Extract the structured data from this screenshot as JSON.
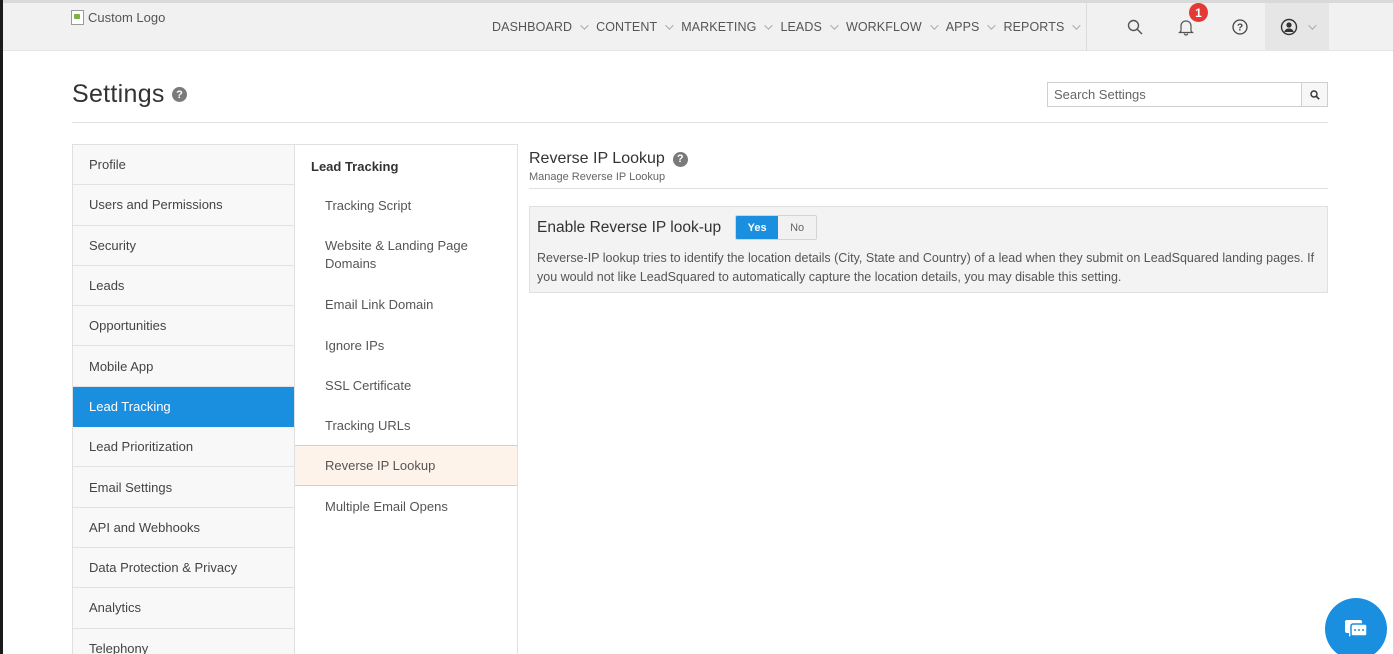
{
  "logo": {
    "alt_text": "Custom Logo"
  },
  "nav": {
    "items": [
      {
        "label": "DASHBOARD"
      },
      {
        "label": "CONTENT"
      },
      {
        "label": "MARKETING"
      },
      {
        "label": "LEADS"
      },
      {
        "label": "WORKFLOW"
      },
      {
        "label": "APPS"
      },
      {
        "label": "REPORTS"
      }
    ],
    "notification_count": "1"
  },
  "header": {
    "title": "Settings",
    "search_placeholder": "Search Settings"
  },
  "left_menu": {
    "items": [
      {
        "label": "Profile"
      },
      {
        "label": "Users and Permissions"
      },
      {
        "label": "Security"
      },
      {
        "label": "Leads"
      },
      {
        "label": "Opportunities"
      },
      {
        "label": "Mobile App"
      },
      {
        "label": "Lead Tracking",
        "active": true
      },
      {
        "label": "Lead Prioritization"
      },
      {
        "label": "Email Settings"
      },
      {
        "label": "API and Webhooks"
      },
      {
        "label": "Data Protection & Privacy"
      },
      {
        "label": "Analytics"
      },
      {
        "label": "Telephony"
      }
    ]
  },
  "sub_menu": {
    "heading": "Lead Tracking",
    "items": [
      {
        "label": "Tracking Script"
      },
      {
        "label": "Website & Landing Page Domains"
      },
      {
        "label": "Email Link Domain"
      },
      {
        "label": "Ignore IPs"
      },
      {
        "label": "SSL Certificate"
      },
      {
        "label": "Tracking URLs"
      },
      {
        "label": "Reverse IP Lookup",
        "active": true
      },
      {
        "label": "Multiple Email Opens"
      }
    ]
  },
  "content": {
    "title": "Reverse IP Lookup",
    "subtitle": "Manage Reverse IP Lookup",
    "setting_label": "Enable Reverse IP look-up",
    "toggle_yes": "Yes",
    "toggle_no": "No",
    "toggle_selected": "Yes",
    "description": "Reverse-IP lookup tries to identify the location details (City, State and Country) of a lead when they submit on LeadSquared landing pages. If you would not like LeadSquared to automatically capture the location details, you may disable this setting."
  },
  "colors": {
    "accent": "#1a8fe0",
    "badge": "#e53935",
    "active_sub_bg": "#fdf3ea"
  },
  "icons": [
    "search-icon",
    "bell-icon",
    "help-icon",
    "user-icon",
    "chat-icon",
    "chevron-down-icon"
  ]
}
